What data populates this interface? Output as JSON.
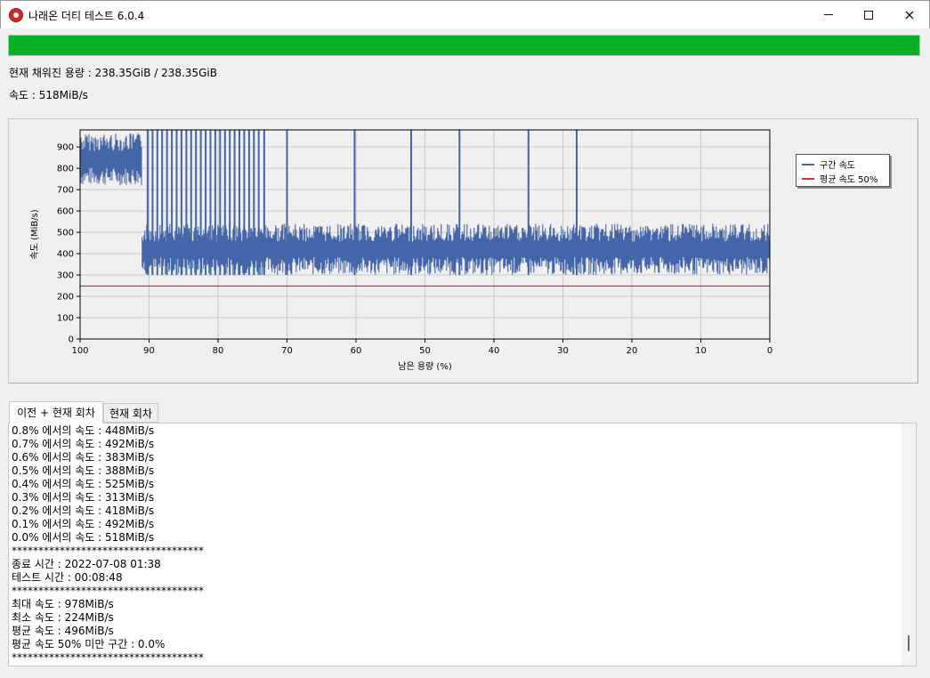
{
  "window": {
    "title": "나래온 더티 테스트 6.0.4",
    "min_glyph": "minimize-icon",
    "max_glyph": "maximize-icon",
    "close_glyph": "×"
  },
  "progress": {
    "fraction": 1.0,
    "color": "#06b025"
  },
  "status": {
    "filled": "현재 채워진 용량 : 238.35GiB / 238.35GiB",
    "speed": "속도 : 518MiB/s"
  },
  "chart_data": {
    "type": "line",
    "xlabel": "남은 용량 (%)",
    "ylabel": "속도 (MiB/s)",
    "xlim": [
      100,
      0
    ],
    "ylim": [
      0,
      980
    ],
    "x_ticks": [
      "100",
      "90",
      "80",
      "70",
      "60",
      "50",
      "40",
      "30",
      "20",
      "10",
      "0"
    ],
    "y_ticks": [
      "0",
      "100",
      "200",
      "300",
      "400",
      "500",
      "600",
      "700",
      "800",
      "900"
    ],
    "grid": true,
    "legend_position": "right",
    "series": [
      {
        "name": "구간 속도",
        "color": "#4466a8",
        "segments": [
          {
            "x_from": 100,
            "x_to": 91,
            "low": 720,
            "high": 965
          },
          {
            "x_from": 91,
            "x_to": 0,
            "low": 300,
            "high": 540
          }
        ],
        "spikes": [
          90.2,
          89.5,
          88.8,
          88.1,
          87.4,
          86.7,
          86.0,
          85.3,
          84.6,
          83.9,
          83.2,
          82.5,
          81.8,
          81.1,
          80.4,
          79.7,
          79.0,
          78.3,
          77.6,
          76.9,
          76.2,
          75.5,
          74.8,
          74.1,
          73.3,
          70.0,
          60.2,
          52.0,
          45.0,
          35.0,
          28.0
        ],
        "min": 224,
        "max": 978
      },
      {
        "name": "평균 속도 50%",
        "color": "#e03030",
        "value": 248
      }
    ]
  },
  "tabs": [
    {
      "label": "이전 + 현재 회차",
      "active": true
    },
    {
      "label": "현재 회차",
      "active": false
    }
  ],
  "log": [
    "0.8% 에서의 속도 : 448MiB/s",
    "0.7% 에서의 속도 : 492MiB/s",
    "0.6% 에서의 속도 : 383MiB/s",
    "0.5% 에서의 속도 : 388MiB/s",
    "0.4% 에서의 속도 : 525MiB/s",
    "0.3% 에서의 속도 : 313MiB/s",
    "0.2% 에서의 속도 : 418MiB/s",
    "0.1% 에서의 속도 : 492MiB/s",
    "0.0% 에서의 속도 : 518MiB/s",
    "************************************",
    "종료 시간 : 2022-07-08 01:38",
    "테스트 시간 : 00:08:48",
    "************************************",
    "최대 속도 : 978MiB/s",
    "최소 속도 : 224MiB/s",
    "평균 속도 : 496MiB/s",
    "평균 속도 50% 미만 구간 : 0.0%",
    "************************************"
  ]
}
